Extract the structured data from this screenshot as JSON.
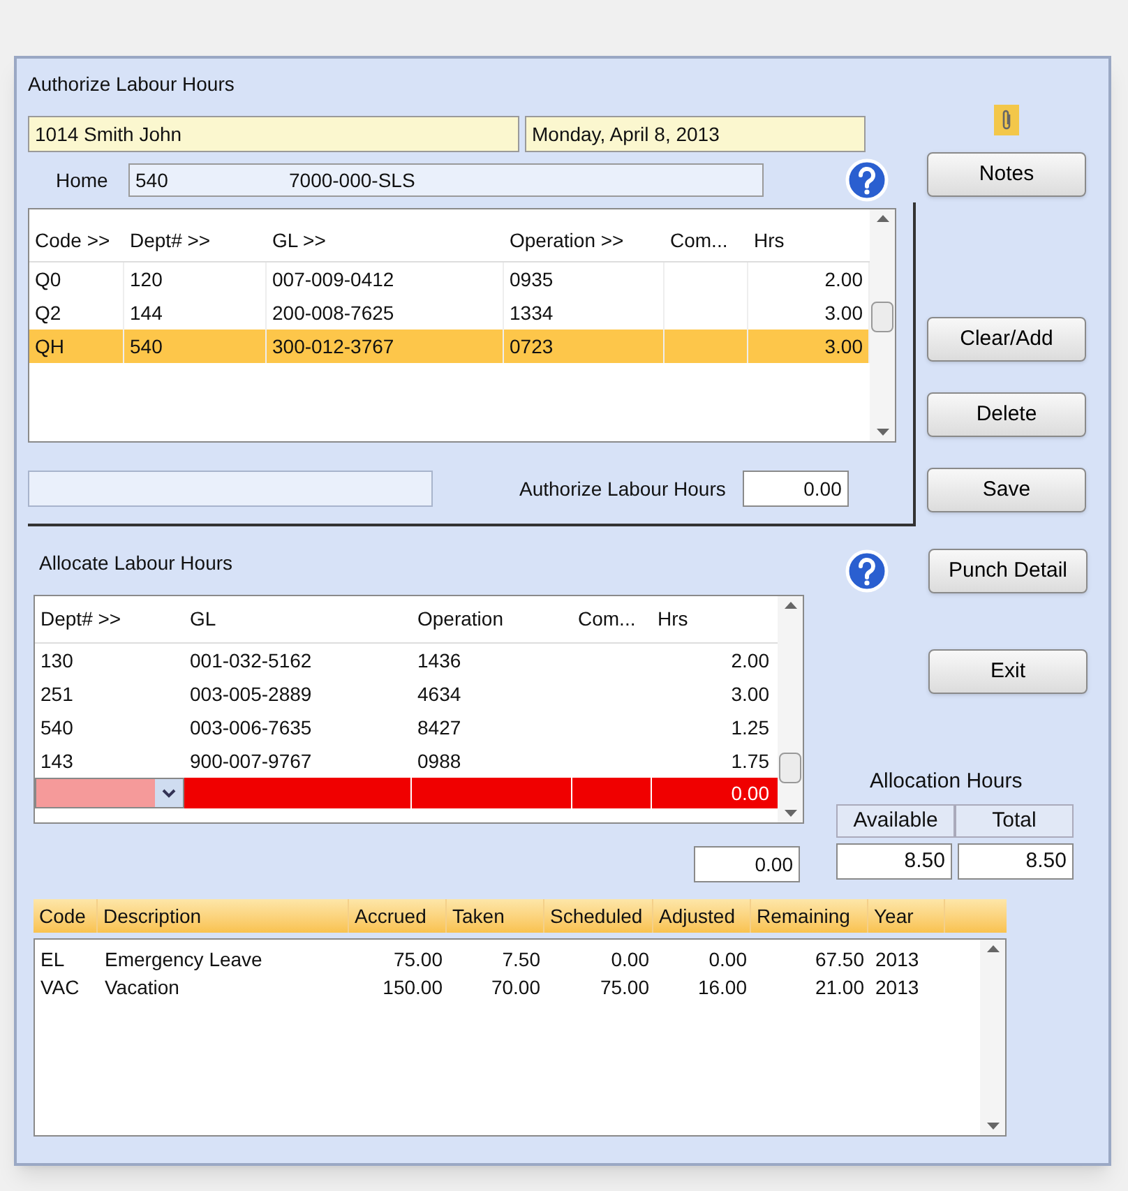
{
  "window": {
    "title": "Authorize Labour Hours"
  },
  "employee_field": "1014 Smith John",
  "date_field": "Monday, April 8, 2013",
  "home": {
    "label": "Home",
    "dept": "540",
    "gl": "7000-000-SLS"
  },
  "authorize": {
    "columns": [
      "Code >>",
      "Dept# >>",
      "GL >>",
      "Operation >>",
      "Com...",
      "Hrs"
    ],
    "rows": [
      {
        "cells": [
          "Q0",
          "120",
          "007-009-0412",
          "0935",
          "",
          "2.00"
        ],
        "selected": false
      },
      {
        "cells": [
          "Q2",
          "144",
          "200-008-7625",
          "1334",
          "",
          "3.00"
        ],
        "selected": false
      },
      {
        "cells": [
          "QH",
          "540",
          "300-012-3767",
          "0723",
          "",
          "3.00"
        ],
        "selected": true
      }
    ],
    "total_label": "Authorize Labour Hours",
    "total": "0.00"
  },
  "allocate": {
    "title": "Allocate Labour Hours",
    "columns": [
      "Dept# >>",
      "GL",
      "Operation",
      "Com...",
      "Hrs"
    ],
    "rows": [
      {
        "cells": [
          "130",
          "001-032-5162",
          "1436",
          "",
          "2.00"
        ]
      },
      {
        "cells": [
          "251",
          "003-005-2889",
          "4634",
          "",
          "3.00"
        ]
      },
      {
        "cells": [
          "540",
          "003-006-7635",
          "8427",
          "",
          "1.25"
        ]
      },
      {
        "cells": [
          "143",
          "900-007-9767",
          "0988",
          "",
          "1.75"
        ]
      }
    ],
    "new_row": {
      "hrs": "0.00"
    },
    "total": "0.00"
  },
  "buttons": [
    "Notes",
    "Clear/Add",
    "Delete",
    "Save",
    "Punch Detail",
    "Exit"
  ],
  "allocation_hours": {
    "title": "Allocation Hours",
    "columns": [
      "Available",
      "Total"
    ],
    "values": [
      "8.50",
      "8.50"
    ]
  },
  "leave": {
    "columns": [
      "Code",
      "Description",
      "Accrued",
      "Taken",
      "Scheduled",
      "Adjusted",
      "Remaining",
      "Year"
    ],
    "rows": [
      {
        "cells": [
          "EL",
          "Emergency Leave",
          "75.00",
          "7.50",
          "0.00",
          "0.00",
          "67.50",
          "2013"
        ]
      },
      {
        "cells": [
          "VAC",
          "Vacation",
          "150.00",
          "70.00",
          "75.00",
          "16.00",
          "21.00",
          "2013"
        ]
      }
    ]
  }
}
